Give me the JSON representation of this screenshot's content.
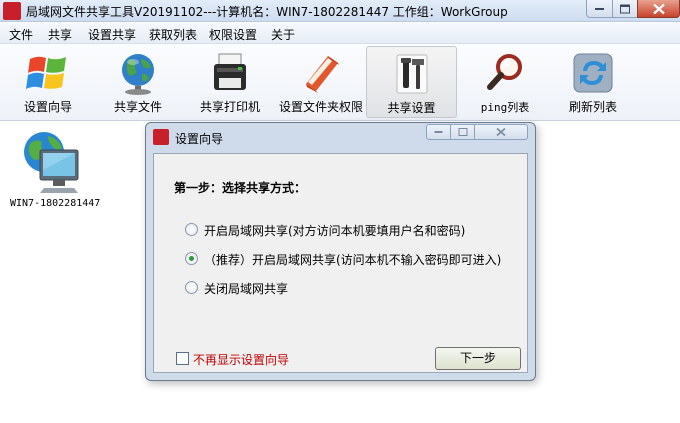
{
  "window": {
    "title": "局域网文件共享工具V20191102---计算机名：WIN7-1802281447  工作组：WorkGroup",
    "icon_text": "修户小改"
  },
  "menu": [
    "文件",
    "共享",
    "设置共享",
    "获取列表",
    "权限设置",
    "关于"
  ],
  "toolbar": [
    {
      "label": "设置向导",
      "icon": "windows-logo-icon"
    },
    {
      "label": "共享文件",
      "icon": "globe-icon"
    },
    {
      "label": "共享打印机",
      "icon": "printer-icon"
    },
    {
      "label": "设置文件夹权限",
      "icon": "folder-book-icon"
    },
    {
      "label": "共享设置",
      "icon": "tools-icon",
      "active": true
    },
    {
      "label": "ping列表",
      "icon": "magnifier-icon"
    },
    {
      "label": "刷新列表",
      "icon": "refresh-icon"
    }
  ],
  "computers": [
    {
      "name": "WIN7-1802281447",
      "icon": "network-computer-icon"
    }
  ],
  "dialog": {
    "title": "设置向导",
    "step_title": "第一步：选择共享方式：",
    "options": [
      {
        "label": "开启局域网共享(对方访问本机要填用户名和密码)",
        "checked": false
      },
      {
        "label": "（推荐）开启局域网共享(访问本机不输入密码即可进入)",
        "checked": true
      },
      {
        "label": "关闭局域网共享",
        "checked": false
      }
    ],
    "dont_show_label": "不再显示设置向导",
    "dont_show_checked": false,
    "next_button": "下一步"
  },
  "colors": {
    "title_bar": "#d9e4f2",
    "close_button": "#c7432b",
    "dialog_frame": "#cfdbeb",
    "checkbox_label": "#c00000",
    "radio_selected": "#2f9a3a"
  }
}
